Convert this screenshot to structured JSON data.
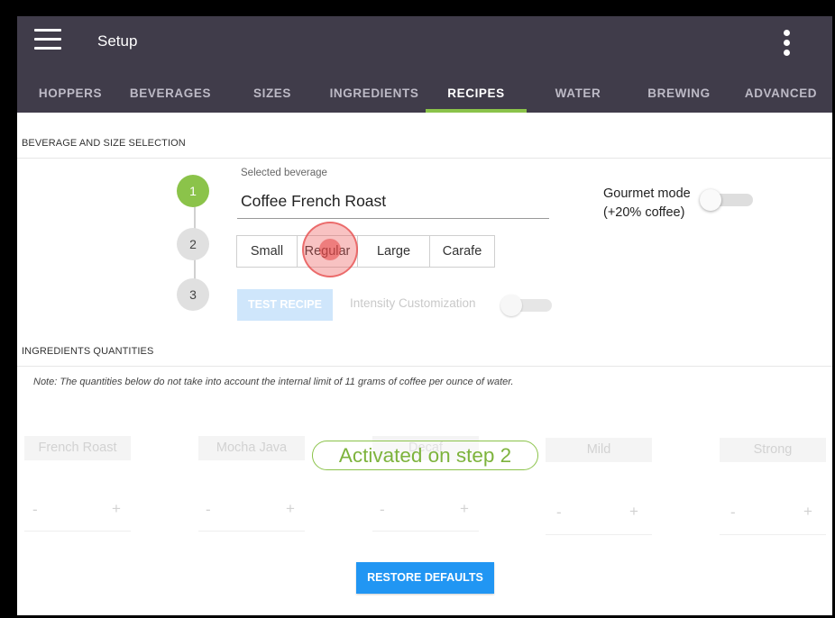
{
  "app": {
    "title": "Setup"
  },
  "tabs": [
    {
      "label": "HOPPERS"
    },
    {
      "label": "BEVERAGES"
    },
    {
      "label": "SIZES"
    },
    {
      "label": "INGREDIENTS"
    },
    {
      "label": "RECIPES",
      "active": true
    },
    {
      "label": "WATER"
    },
    {
      "label": "BREWING"
    },
    {
      "label": "ADVANCED"
    }
  ],
  "beverage_section": {
    "heading": "BEVERAGE AND SIZE SELECTION",
    "steps": [
      "1",
      "2",
      "3"
    ],
    "selected_label": "Selected beverage",
    "selected_value": "Coffee French Roast",
    "sizes": [
      "Small",
      "Regular",
      "Large",
      "Carafe"
    ],
    "test_recipe": "TEST RECIPE",
    "intensity_label": "Intensity Customization",
    "intensity_on": false,
    "gourmet_label_line1": "Gourmet mode",
    "gourmet_label_line2": "(+20% coffee)",
    "gourmet_on": false
  },
  "ingredients_section": {
    "heading": "INGREDIENTS QUANTITIES",
    "note": "Note: The quantities below do not take into account the internal limit of 11 grams of coffee per ounce of water.",
    "ingredients": [
      {
        "name": "French Roast"
      },
      {
        "name": "Mocha Java"
      },
      {
        "name": "Decaf"
      },
      {
        "name": "Mild"
      },
      {
        "name": "Strong"
      }
    ],
    "minus": "-",
    "plus": "+"
  },
  "overlay": {
    "activated_text": "Activated on step 2"
  },
  "restore_defaults": "RESTORE DEFAULTS",
  "colors": {
    "appbar": "#403c4a",
    "accent_green": "#8bc34a",
    "primary_blue": "#2196f3"
  }
}
